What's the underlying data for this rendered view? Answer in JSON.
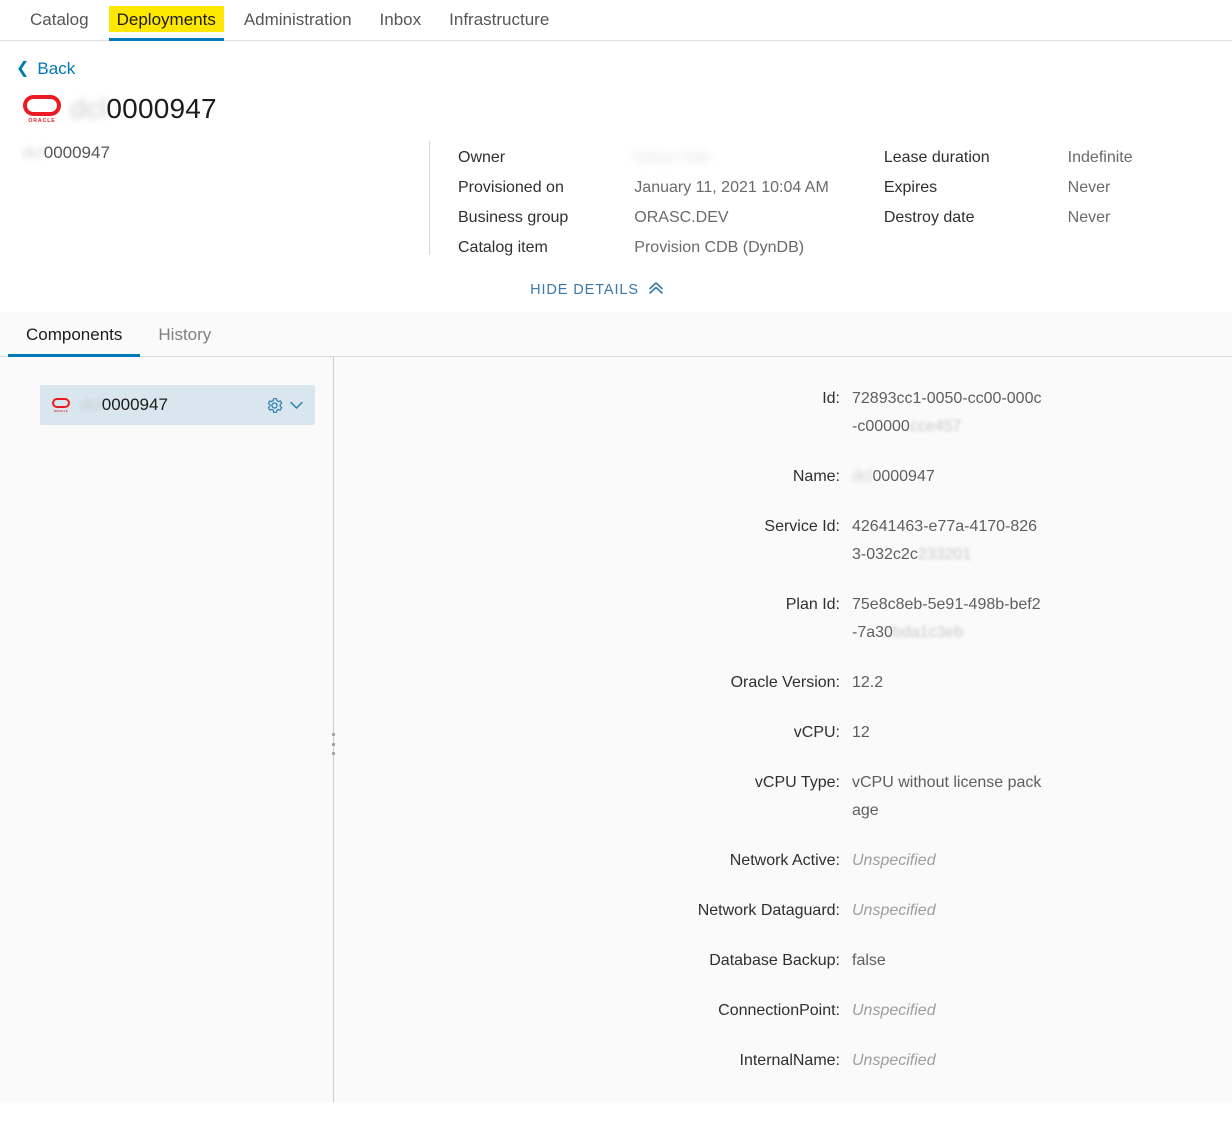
{
  "nav": {
    "items": [
      {
        "label": "Catalog",
        "active": false
      },
      {
        "label": "Deployments",
        "active": true
      },
      {
        "label": "Administration",
        "active": false
      },
      {
        "label": "Inbox",
        "active": false
      },
      {
        "label": "Infrastructure",
        "active": false
      }
    ],
    "highlight_color": "#ffe800",
    "active_underline_color": "#0079b8"
  },
  "back": {
    "label": "Back",
    "icon": "chevron-left-icon"
  },
  "header": {
    "logo": "oracle-logo",
    "logo_word": "ORACLE",
    "title_prefix": "dcl",
    "title_suffix": "0000947",
    "deployment_name_prefix": "dcl",
    "deployment_name_suffix": "0000947"
  },
  "details": {
    "left_column": [
      {
        "label": "Owner",
        "value": "Erkan Onk",
        "redacted": true
      },
      {
        "label": "Provisioned on",
        "value": "January 11, 2021 10:04 AM",
        "redacted": false
      },
      {
        "label": "Business group",
        "value": "ORASC.DEV",
        "redacted": false
      },
      {
        "label": "Catalog item",
        "value": "Provision CDB (DynDB)",
        "redacted": false
      }
    ],
    "right_column": [
      {
        "label": "Lease duration",
        "value": "Indefinite"
      },
      {
        "label": "Expires",
        "value": "Never"
      },
      {
        "label": "Destroy date",
        "value": "Never"
      }
    ],
    "hide_details_label": "HIDE DETAILS",
    "hide_details_icon": "double-chevron-up-icon"
  },
  "tabs": [
    {
      "label": "Components",
      "active": true
    },
    {
      "label": "History",
      "active": false
    }
  ],
  "components_panel": {
    "item": {
      "logo": "oracle-logo",
      "logo_word": "ORACLE",
      "name_prefix": "dcl",
      "name_suffix": "0000947",
      "gear_icon": "gear-icon",
      "chevron_icon": "chevron-down-icon"
    }
  },
  "properties": [
    {
      "label": "Id:",
      "value": "72893cc1-0050-cc00-000c-c00000",
      "tail": "cce457",
      "style": "normal"
    },
    {
      "label": "Name:",
      "prefix": "dcl",
      "value": "0000947",
      "style": "prefix-blur"
    },
    {
      "label": "Service Id:",
      "value": "42641463-e77a-4170-8263-032c2c",
      "tail": "233201",
      "style": "normal"
    },
    {
      "label": "Plan Id:",
      "value": "75e8c8eb-5e91-498b-bef2-7a30",
      "tail": "bda1c3eb",
      "style": "normal"
    },
    {
      "label": "Oracle Version:",
      "value": "12.2",
      "style": "normal"
    },
    {
      "label": "vCPU:",
      "value": "12",
      "style": "normal"
    },
    {
      "label": "vCPU Type:",
      "value": "vCPU without license package",
      "style": "normal"
    },
    {
      "label": "Network Active:",
      "value": "Unspecified",
      "style": "unspecified"
    },
    {
      "label": "Network Dataguard:",
      "value": "Unspecified",
      "style": "unspecified"
    },
    {
      "label": "Database Backup:",
      "value": "false",
      "style": "normal"
    },
    {
      "label": "ConnectionPoint:",
      "value": "Unspecified",
      "style": "unspecified"
    },
    {
      "label": "InternalName:",
      "value": "Unspecified",
      "style": "unspecified"
    }
  ]
}
